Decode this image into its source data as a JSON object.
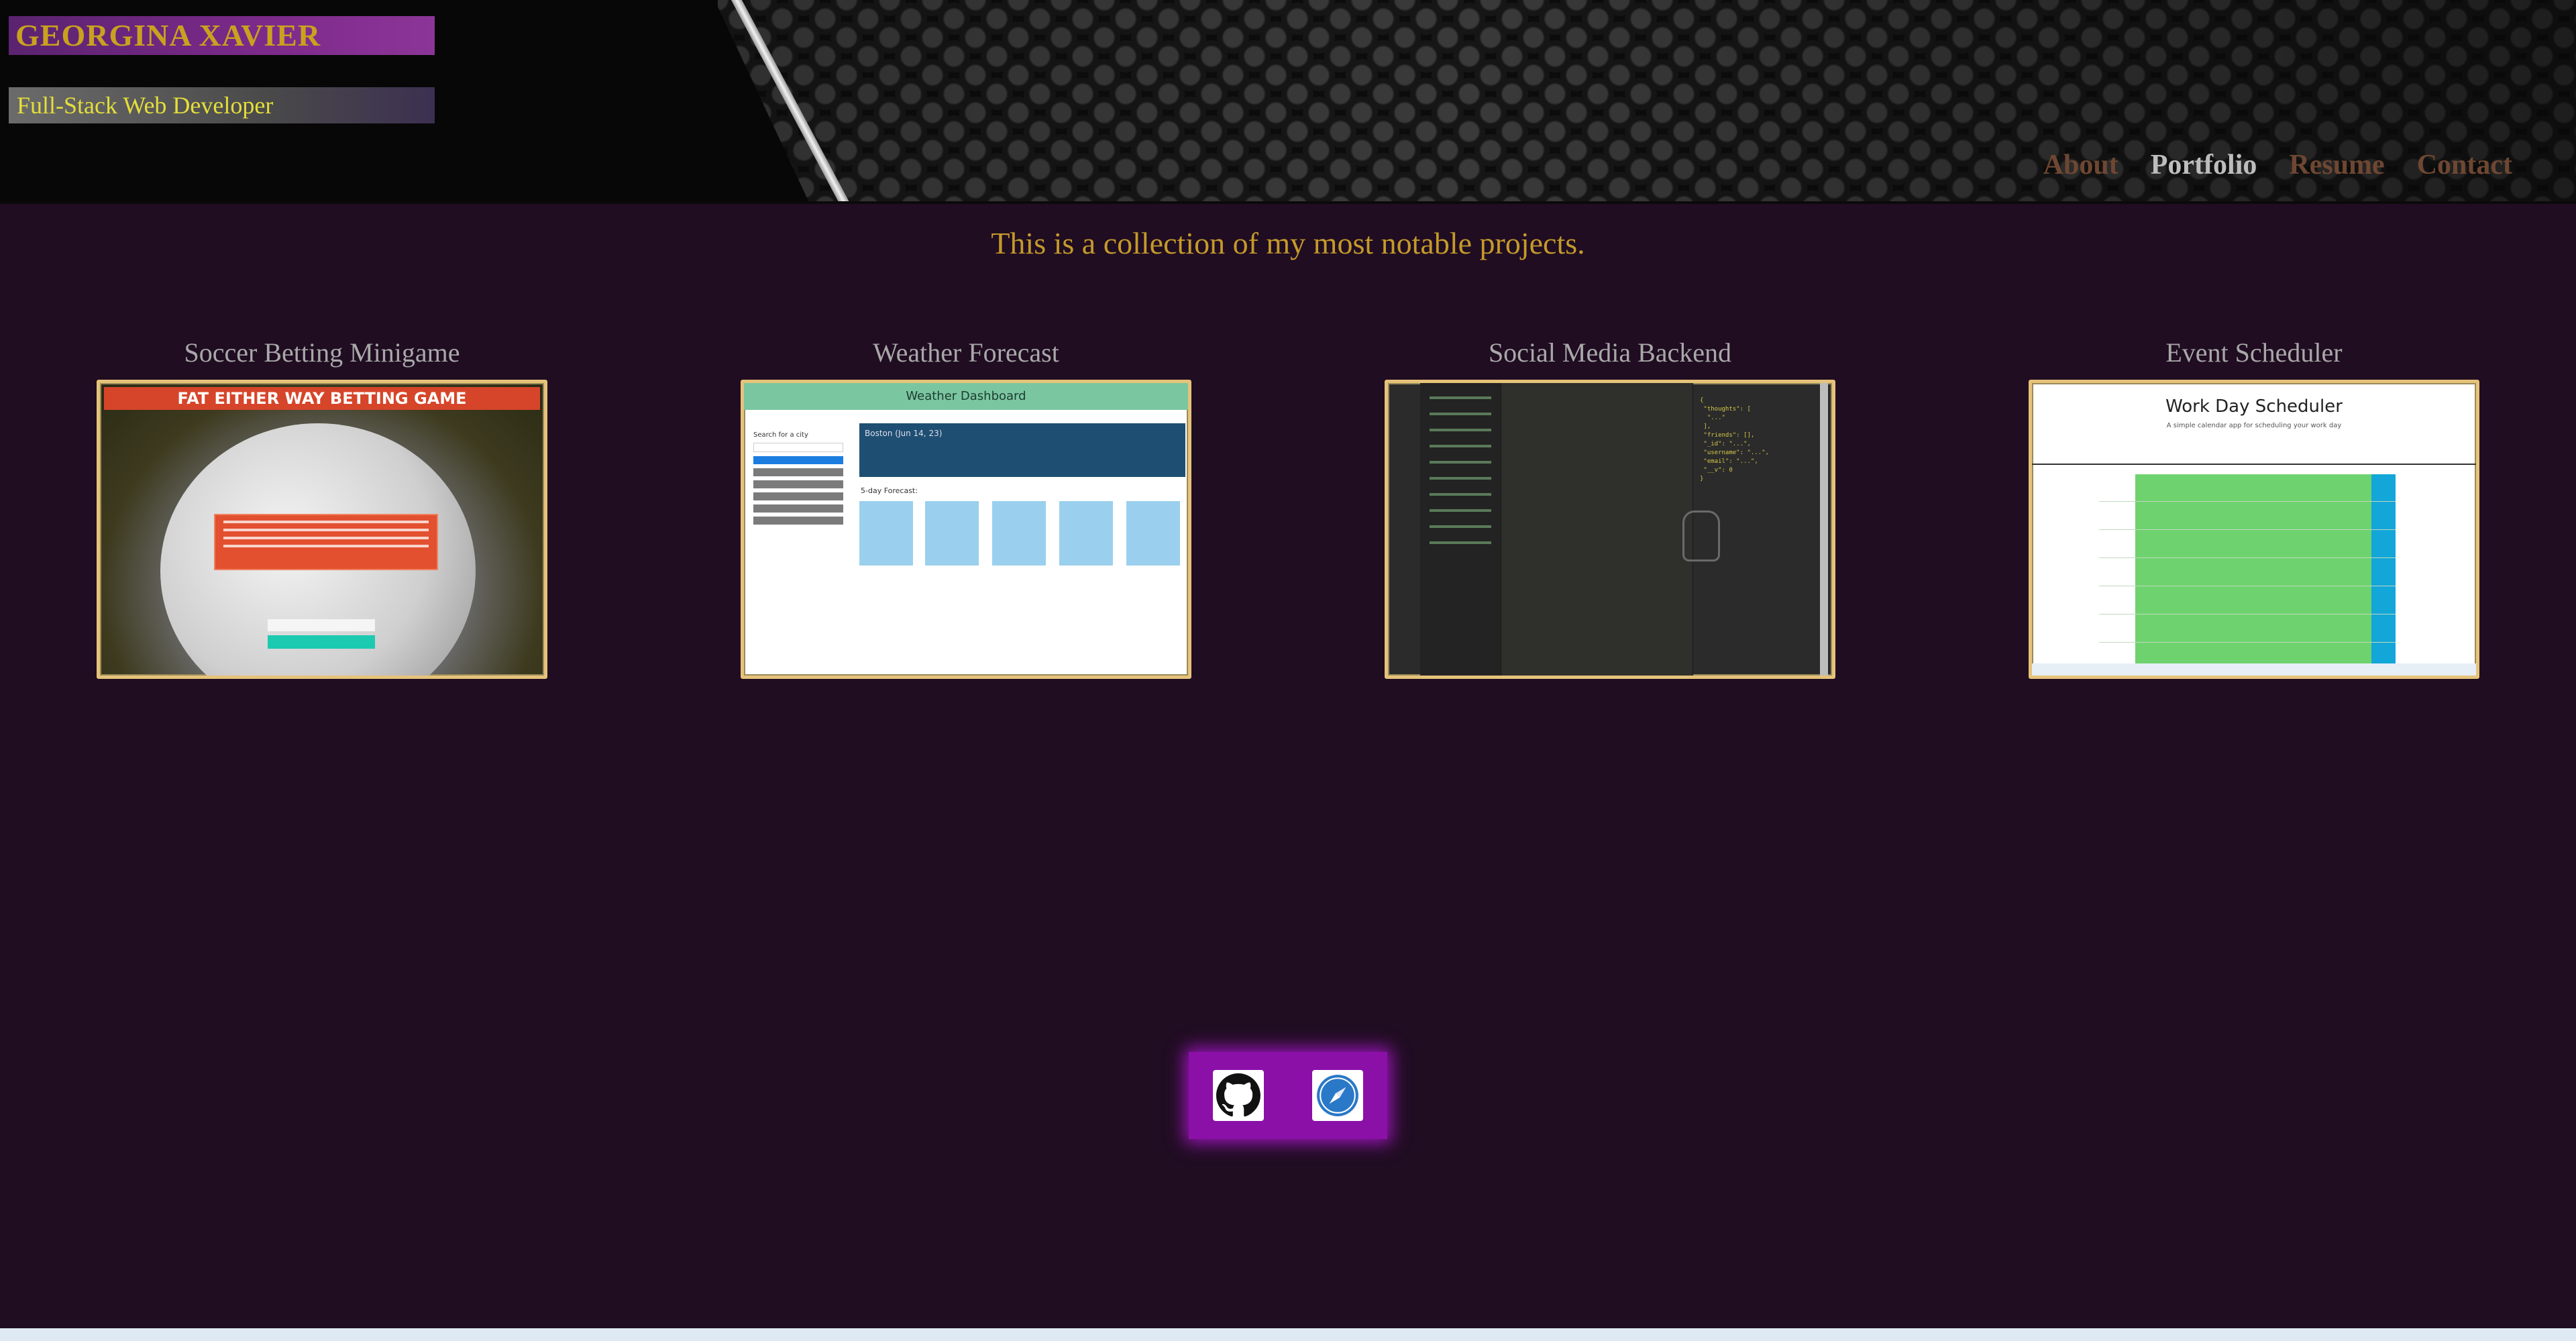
{
  "header": {
    "name": "GEORGINA XAVIER",
    "subtitle": "Full-Stack Web Developer",
    "nav": [
      {
        "label": "About",
        "active": false
      },
      {
        "label": "Portfolio",
        "active": true
      },
      {
        "label": "Resume",
        "active": false
      },
      {
        "label": "Contact",
        "active": false
      }
    ]
  },
  "intro": "This is a collection of my most notable projects.",
  "projects": [
    {
      "title": "Soccer Betting Minigame",
      "thumbnail_banner": "FAT EITHER WAY BETTING GAME"
    },
    {
      "title": "Weather Forecast",
      "thumbnail_header": "Weather Dashboard",
      "thumbnail_search_label": "Search for a city",
      "thumbnail_city": "Boston (Jun 14, 23)",
      "thumbnail_forecast_label": "5-day Forecast:"
    },
    {
      "title": "Social Media Backend"
    },
    {
      "title": "Event Scheduler",
      "thumbnail_heading": "Work Day Scheduler",
      "thumbnail_subheading": "A simple calendar app for scheduling your work day"
    }
  ],
  "footer": {
    "icons": [
      "github-icon",
      "compass-icon"
    ]
  },
  "colors": {
    "background": "#200d22",
    "accent_gold": "#c49a2a",
    "nav_inactive": "#6e4732",
    "footer_purple": "#8a10a8",
    "thumbnail_border": "#e6c37a"
  }
}
